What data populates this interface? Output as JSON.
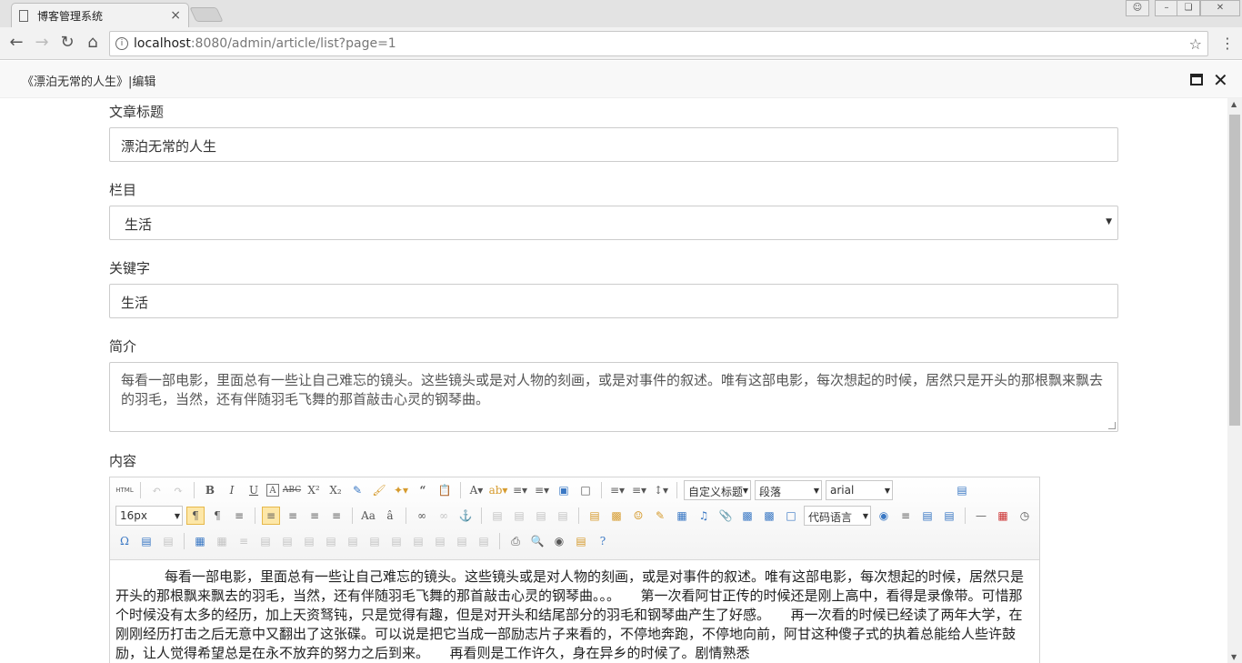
{
  "browser": {
    "tab_title": "博客管理系统",
    "tab_close": "×",
    "url_host": "localhost",
    "url_rest": ":8080/admin/article/list?page=1",
    "window_buttons": [
      "user-icon",
      "minimize-icon",
      "restore-icon",
      "close-icon"
    ]
  },
  "layer": {
    "title": "《漂泊无常的人生》|编辑"
  },
  "form": {
    "title_label": "文章标题",
    "title_value": "漂泊无常的人生",
    "category_label": "栏目",
    "category_value": "生活",
    "keywords_label": "关键字",
    "keywords_value": "生活",
    "summary_label": "简介",
    "summary_value": "每看一部电影，里面总有一些让自己难忘的镜头。这些镜头或是对人物的刻画，或是对事件的叙述。唯有这部电影，每次想起的时候，居然只是开头的那根飘来飘去的羽毛，当然，还有伴随羽毛飞舞的那首敲击心灵的钢琴曲。",
    "content_label": "内容"
  },
  "editor": {
    "html_label": "HTML",
    "heading_select": "自定义标题",
    "paragraph_select": "段落",
    "font_select": "arial",
    "size_select": "16px",
    "code_select": "代码语言",
    "body": "每看一部电影，里面总有一些让自己难忘的镜头。这些镜头或是对人物的刻画，或是对事件的叙述。唯有这部电影，每次想起的时候，居然只是开头的那根飘来飘去的羽毛，当然，还有伴随羽毛飞舞的那首敲击心灵的钢琴曲。。。　　第一次看阿甘正传的时候还是刚上高中，看得是录像带。可惜那个时候没有太多的经历，加上天资驽钝，只是觉得有趣，但是对开头和结尾部分的羽毛和钢琴曲产生了好感。　　再一次看的时候已经读了两年大学，在刚刚经历打击之后无意中又翻出了这张碟。可以说是把它当成一部励志片子来看的，不停地奔跑，不停地向前，阿甘这种傻子式的执着总能给人些许鼓励，让人觉得希望总是在永不放弃的努力之后到来。　　再看则是工作许久，身在异乡的时候了。剧情熟悉"
  }
}
